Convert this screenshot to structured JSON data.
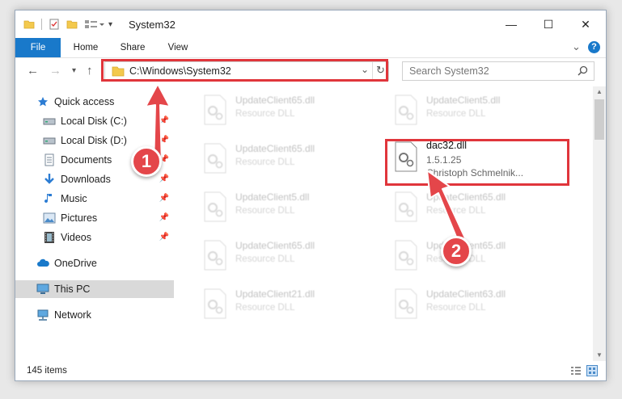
{
  "window": {
    "title": "System32",
    "controls": {
      "minimize": "—",
      "maximize": "☐",
      "close": "✕"
    }
  },
  "ribbon": {
    "tabs": [
      "File",
      "Home",
      "Share",
      "View"
    ],
    "expand": "⌄",
    "help": "?"
  },
  "address": {
    "path": "C:\\Windows\\System32",
    "search_placeholder": "Search System32"
  },
  "navigation": {
    "items": [
      {
        "label": "Quick access",
        "icon": "star-icon"
      },
      {
        "label": "Local Disk (C:)",
        "icon": "drive-icon",
        "pinned": true
      },
      {
        "label": "Local Disk (D:)",
        "icon": "drive-icon",
        "pinned": true
      },
      {
        "label": "Documents",
        "icon": "documents-icon",
        "pinned": true
      },
      {
        "label": "Downloads",
        "icon": "download-icon",
        "pinned": true
      },
      {
        "label": "Music",
        "icon": "music-icon",
        "pinned": true
      },
      {
        "label": "Pictures",
        "icon": "pictures-icon",
        "pinned": true
      },
      {
        "label": "Videos",
        "icon": "videos-icon",
        "pinned": true
      },
      {
        "label": "OneDrive",
        "icon": "cloud-icon"
      },
      {
        "label": "This PC",
        "icon": "computer-icon",
        "selected": true
      },
      {
        "label": "Network",
        "icon": "network-icon"
      }
    ]
  },
  "files": [
    {
      "name": "UpdateClient65.dll",
      "type": "Resource DLL"
    },
    {
      "name": "UpdateClient5.dll",
      "type": "Resource DLL"
    },
    {
      "name": "UpdateClient65.dll",
      "type": "Resource DLL"
    },
    {
      "name": "UpdateClient5.dll",
      "type": "Resource DLL"
    },
    {
      "name": "UpdateClient65.dll",
      "type": "Resource DLL"
    },
    {
      "name": "UpdateClient65.dll",
      "type": "Resource DLL"
    },
    {
      "name": "UpdateClient65.dll",
      "type": "Resource DLL"
    },
    {
      "name": "UpdateClient21.dll",
      "type": "Resource DLL"
    },
    {
      "name": "UpdateClient63.dll",
      "type": "Resource DLL"
    }
  ],
  "selected_file": {
    "name": "dac32.dll",
    "version": "1.5.1.25",
    "company": "Christoph Schmelnik..."
  },
  "status": {
    "count": "145 items"
  },
  "annotations": {
    "step1": "1",
    "step2": "2",
    "color": "#e0353b"
  }
}
